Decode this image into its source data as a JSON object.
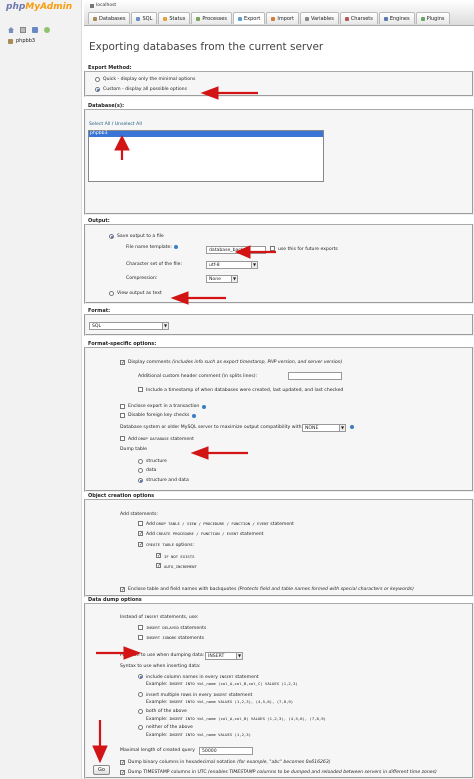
{
  "sidebar": {
    "logo_a": "php",
    "logo_b": "MyAdmin",
    "db": "phpbb3"
  },
  "topbar": {
    "server": "localhost",
    "tabs": [
      "Databases",
      "SQL",
      "Status",
      "Processes",
      "Export",
      "Import",
      "Variables",
      "Charsets",
      "Engines",
      "Plugins"
    ]
  },
  "page_title": "Exporting databases from the current server",
  "export_method": {
    "legend": "Export Method:",
    "quick": "Quick - display only the minimal options",
    "custom": "Custom - display all possible options"
  },
  "databases": {
    "legend": "Database(s):",
    "select_all": "Select All / Unselect All",
    "item": "phpbb3"
  },
  "output": {
    "legend": "Output:",
    "save": "Save output to a file",
    "filename_label": "File name template:",
    "filename_value": "database_backup",
    "use_future": "use this for future exports",
    "charset_label": "Character set of the file:",
    "charset_value": "utf-8",
    "compression_label": "Compression:",
    "compression_value": "None",
    "view_text": "View output as text"
  },
  "format": {
    "legend": "Format:",
    "value": "SQL"
  },
  "format_options": {
    "legend": "Format-specific options:",
    "display_comments": "Display comments",
    "display_comments_note": "(includes info such as export timestamp, PHP version, and server version)",
    "add_header": "Additional custom header comment (\\n splits lines):",
    "include_timestamp": "Include a timestamp of when databases were created, last updated, and last checked",
    "enclose_transaction": "Enclose export in a transaction",
    "disable_fk": "Disable foreign key checks",
    "compat_label": "Database system or older MySQL server to maximize output compatibility with:",
    "compat_value": "NONE",
    "add_drop_db_pre": "Add",
    "add_drop_db_code": "DROP DATABASE",
    "add_drop_db_post": "statement",
    "dump_table": "Dump table",
    "structure": "structure",
    "data": "data",
    "structure_and_data": "structure and data"
  },
  "object_creation": {
    "legend": "Object creation options",
    "add_statements": "Add statements:",
    "add_drop_pre": "Add",
    "add_drop_code": "DROP TABLE / VIEW / PROCEDURE / FUNCTION / EVENT",
    "add_drop_post": "statement",
    "add_create_pre": "Add",
    "add_create_code": "CREATE PROCEDURE / FUNCTION / EVENT",
    "add_create_post": "statement",
    "create_table_code": "CREATE TABLE",
    "create_table_post": "options:",
    "if_not_exists": "IF NOT EXISTS",
    "auto_increment": "AUTO_INCREMENT",
    "backquotes": "Enclose table and field names with backquotes",
    "backquotes_note": "(Protects field and table names formed with special characters or keywords)"
  },
  "data_dump": {
    "legend": "Data dump options",
    "instead_pre": "Instead of",
    "instead_code": "INSERT",
    "instead_post": "statements, use:",
    "insert_delayed_code": "INSERT DELAYED",
    "insert_delayed_post": "statements",
    "insert_ignore_code": "INSERT IGNORE",
    "insert_ignore_post": "statements",
    "function_label": "Function to use when dumping data:",
    "function_value": "INSERT",
    "syntax_label": "Syntax to use when inserting data:",
    "opt1": "include column names in every",
    "opt1_code": "INSERT",
    "opt1_post": "statement",
    "opt1_example_label": "Example:",
    "opt1_example": "INSERT INTO tbl_name (col_A,col_B,col_C) VALUES (1,2,3)",
    "opt2": "insert multiple rows in every",
    "opt2_code": "INSERT",
    "opt2_post": "statement",
    "opt2_example_label": "Example:",
    "opt2_example": "INSERT INTO tbl_name VALUES (1,2,3), (4,5,6), (7,8,9)",
    "opt3": "both of the above",
    "opt3_example_label": "Example:",
    "opt3_example": "INSERT INTO tbl_name (col_A,col_B) VALUES (1,2,3), (4,5,6), (7,8,9)",
    "opt4": "neither of the above",
    "opt4_example_label": "Example:",
    "opt4_example": "INSERT INTO tbl_name VALUES (1,2,3)",
    "max_query_label": "Maximal length of created query",
    "max_query_value": "50000",
    "binary_hex": "Dump binary columns in hexadecimal notation",
    "binary_hex_note": "(for example, \"abc\" becomes 0x616263)",
    "timestamp_utc": "Dump TIMESTAMP columns in UTC",
    "timestamp_utc_note": "(enables TIMESTAMP columns to be dumped and reloaded between servers in different time zones)"
  },
  "go": "Go",
  "colors": {
    "arrow": "#d21414",
    "accent": "#3875d7"
  }
}
